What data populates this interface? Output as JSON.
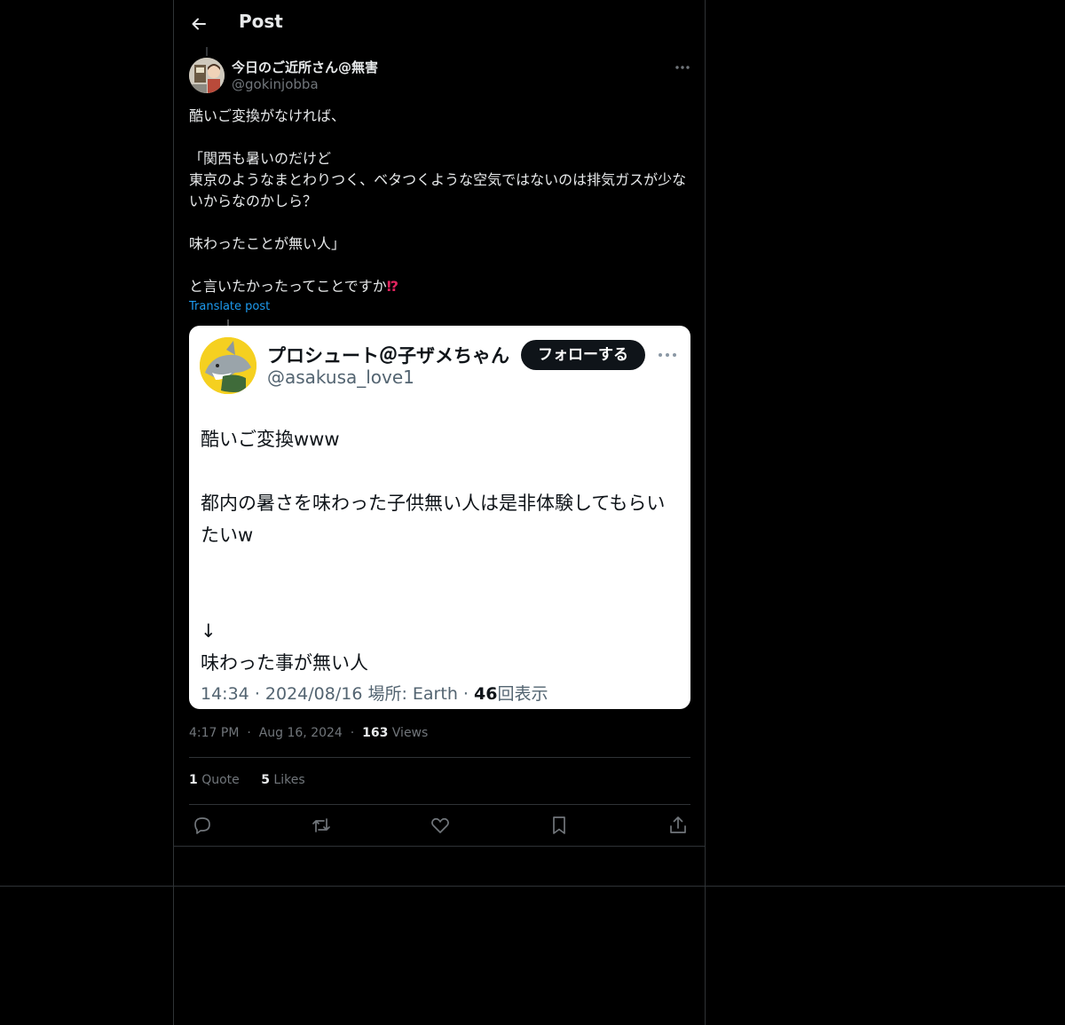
{
  "header": {
    "title": "Post"
  },
  "author": {
    "display_name": "今日のご近所さん@無害",
    "handle": "@gokinjobba"
  },
  "post": {
    "text": "酷いご変換がなければ、\n\n「関西も暑いのだけど\n東京のようなまとわりつく、ベタつくような空気ではないのは排気ガスが少ないからなのかしら？\n\n味わったことが無い人」\n\nと言いたかったってことですか",
    "emoji": "⁉",
    "translate_label": "Translate post"
  },
  "embed": {
    "display_name": "プロシュート＠子ザメちゃん",
    "handle": "@asakusa_love1",
    "follow_label": "フォローする",
    "text": "酷いご変換www\n\n都内の暑さを味わった子供無い人は是非体験してもらいたいw\n\n\n↓\n味わった事が無い人",
    "time": "14:34",
    "date": "2024/08/16",
    "place": "場所: Earth",
    "views_count": "46",
    "views_label": "回表示",
    "dot": "·"
  },
  "meta": {
    "time": "4:17 PM",
    "date": "Aug 16, 2024",
    "views_count": "163",
    "views_label": "Views",
    "dot": "·"
  },
  "stats": {
    "quotes_count": "1",
    "quotes_label": "Quote",
    "likes_count": "5",
    "likes_label": "Likes"
  },
  "icons": [
    "back-arrow-icon",
    "more-icon",
    "reply-icon",
    "repost-icon",
    "like-icon",
    "bookmark-icon",
    "share-icon"
  ],
  "colors": {
    "background": "#000000",
    "accent": "#1d9bf0",
    "muted": "#71767b",
    "border": "#2f3336"
  }
}
